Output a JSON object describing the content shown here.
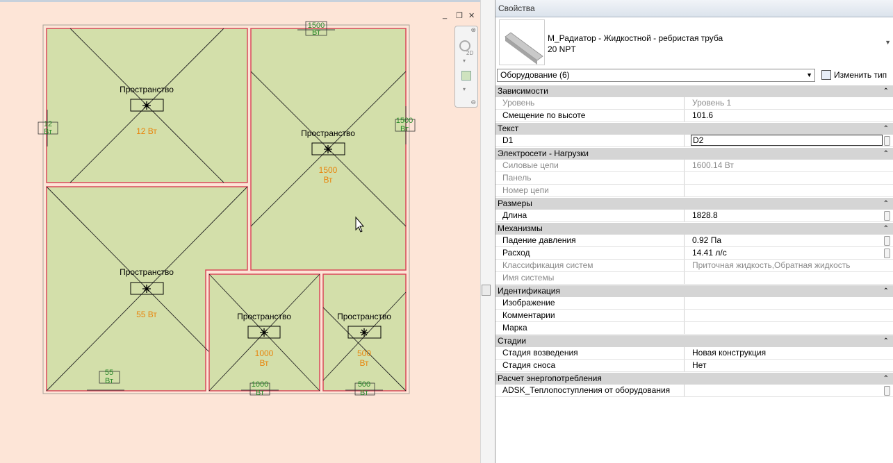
{
  "canvas": {
    "view_controls": [
      "_",
      "❐",
      "✕"
    ],
    "nav_bar_label": "2D",
    "rooms": [
      {
        "label": "Пространство",
        "load_line1": "12 Вт",
        "load_line2": ""
      },
      {
        "label": "Пространство",
        "load_line1": "1500",
        "load_line2": "Вт"
      },
      {
        "label": "Пространство",
        "load_line1": "55 Вт",
        "load_line2": ""
      },
      {
        "label": "Пространство",
        "load_line1": "1000",
        "load_line2": "Вт"
      },
      {
        "label": "Пространство",
        "load_line1": "500",
        "load_line2": "Вт"
      }
    ],
    "tags": [
      {
        "line1": "1500",
        "line2": "Вт"
      },
      {
        "line1": "12",
        "line2": "Вт"
      },
      {
        "line1": "1500",
        "line2": "Вт"
      },
      {
        "line1": "55",
        "line2": "Вт"
      },
      {
        "line1": "1000",
        "line2": "Вт"
      },
      {
        "line1": "500",
        "line2": "Вт"
      }
    ],
    "colors": {
      "background": "#fde5d7",
      "room_fill": "#d3dfaa",
      "room_border": "#d9495a",
      "load_text": "#e8850c",
      "tag_text": "#2a8a2a"
    }
  },
  "panel": {
    "title": "Свойства",
    "type_name_line1": "М_Радиатор - Жидкостной - ребристая труба",
    "type_name_line2": "20 NPT",
    "category_select": "Оборудование (6)",
    "edit_type_label": "Изменить тип",
    "sections": [
      {
        "title": "Зависимости",
        "rows": [
          {
            "key": "Уровень",
            "value": "Уровень 1",
            "disabled": true
          },
          {
            "key": "Смещение по высоте",
            "value": "101.6",
            "disabled": false
          }
        ]
      },
      {
        "title": "Текст",
        "rows": [
          {
            "key": "D1",
            "value": "D2",
            "disabled": false,
            "editing": true
          }
        ]
      },
      {
        "title": "Электросети - Нагрузки",
        "rows": [
          {
            "key": "Силовые цепи",
            "value": "1600.14 Вт",
            "disabled": true
          },
          {
            "key": "Панель",
            "value": "",
            "disabled": true
          },
          {
            "key": "Номер цепи",
            "value": "",
            "disabled": true
          }
        ]
      },
      {
        "title": "Размеры",
        "rows": [
          {
            "key": "Длина",
            "value": "1828.8",
            "disabled": false
          }
        ]
      },
      {
        "title": "Механизмы",
        "rows": [
          {
            "key": "Падение давления",
            "value": "0.92 Па",
            "disabled": false
          },
          {
            "key": "Расход",
            "value": "14.41 л/с",
            "disabled": false
          },
          {
            "key": "Классификация систем",
            "value": "Приточная жидкость,Обратная жидкость",
            "disabled": true
          },
          {
            "key": "Имя системы",
            "value": "",
            "disabled": true
          }
        ]
      },
      {
        "title": "Идентификация",
        "rows": [
          {
            "key": "Изображение",
            "value": "",
            "disabled": false
          },
          {
            "key": "Комментарии",
            "value": "",
            "disabled": false
          },
          {
            "key": "Марка",
            "value": "",
            "disabled": false
          }
        ]
      },
      {
        "title": "Стадии",
        "rows": [
          {
            "key": "Стадия возведения",
            "value": "Новая конструкция",
            "disabled": false
          },
          {
            "key": "Стадия сноса",
            "value": "Нет",
            "disabled": false
          }
        ]
      },
      {
        "title": "Расчет энергопотребления",
        "rows": [
          {
            "key": "ADSK_Теплопоступления от оборудования",
            "value": "",
            "disabled": false
          }
        ]
      }
    ]
  }
}
